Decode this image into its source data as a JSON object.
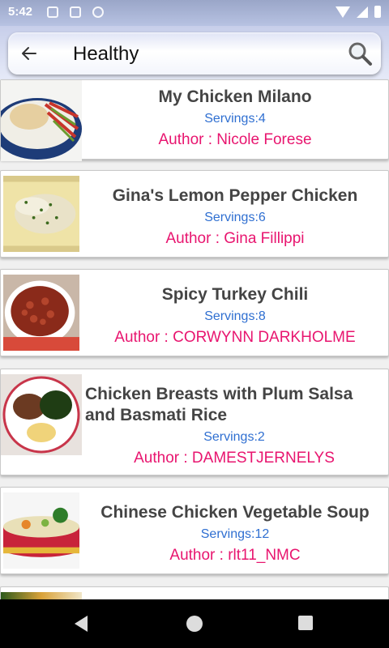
{
  "status_bar": {
    "time": "5:42"
  },
  "search": {
    "query": "Healthy"
  },
  "recipes": [
    {
      "title": "My Chicken Milano",
      "servings": "Servings:4",
      "author": "Author : Nicole Forese",
      "image": "plated-chicken-with-peppers"
    },
    {
      "title": "Gina's Lemon Pepper Chicken",
      "servings": "Servings:6",
      "author": "Author : Gina Fillippi",
      "image": "chicken-breasts-with-herbs"
    },
    {
      "title": "Spicy Turkey Chili",
      "servings": "Servings:8",
      "author": "Author : CORWYNN DARKHOLME",
      "image": "bowl-of-chili"
    },
    {
      "title": "Chicken Breasts with Plum Salsa and Basmati Rice",
      "servings": "Servings:2",
      "author": "Author : DAMESTJERNELYS",
      "image": "chicken-with-spinach-and-rice"
    },
    {
      "title": "Chinese Chicken Vegetable Soup",
      "servings": "Servings:12",
      "author": "Author : rlt11_NMC",
      "image": "vegetable-soup-bowl"
    }
  ],
  "colors": {
    "author": "#e8156f",
    "servings": "#2f6fd1",
    "title": "#444444"
  },
  "icons": {
    "back": "arrow-left-icon",
    "search": "magnifier-icon"
  }
}
